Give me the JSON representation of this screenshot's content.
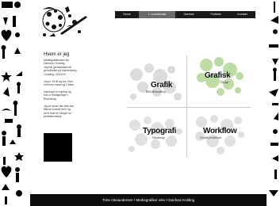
{
  "nav": {
    "items": [
      "Home",
      "1. hovedforløb",
      "Gartnea",
      "Portfolio",
      "Kontakt"
    ],
    "active_index": 1
  },
  "sidebar": {
    "title": "Hvem er jeg",
    "paragraphs": [
      "Mediegrafikerelev fra\nDanfoss i Kolding.\nJeg har gennemført mit\ngrundforløb på Hansenberg\ni Kolding i 2013/14",
      "Jeg er 19 år og bor i Bov\nmed min mand og 2 børn.",
      "Interesser er syning og\nfoto & Redigeringer i\nPhotoshop.",
      "Jeg er byder der ikke kan\nfåle at komme frem og\nse til fode en simple for\nperfektionistisk."
    ]
  },
  "quadrants": [
    {
      "title": "Grafik",
      "subtitle": "Billedbehandling",
      "accent": "#d8d8d8"
    },
    {
      "title": "Grafisk",
      "subtitle": "Design",
      "accent": "#b9dca0"
    },
    {
      "title": "Typografi",
      "subtitle": "Opsætning",
      "accent": "#d8d8d8"
    },
    {
      "title": "Workflow",
      "subtitle": "Grafisk produktion",
      "accent": "#d8d8d8"
    }
  ],
  "footer": {
    "text": "Trine Alexandersen • Mediegrafiker elev • Danfoss Kolding"
  },
  "colors": {
    "nav_bg": "#1a1a1a",
    "nav_active": "#6a6a6a",
    "footer_bg": "#0d0d0d",
    "accent_green": "#b9dca0"
  },
  "icons": [
    "pig-icon",
    "heart-icon",
    "star-icon",
    "bird-icon",
    "tree-icon",
    "person-icon",
    "ant-icon",
    "pencil-icon",
    "camera-icon"
  ]
}
